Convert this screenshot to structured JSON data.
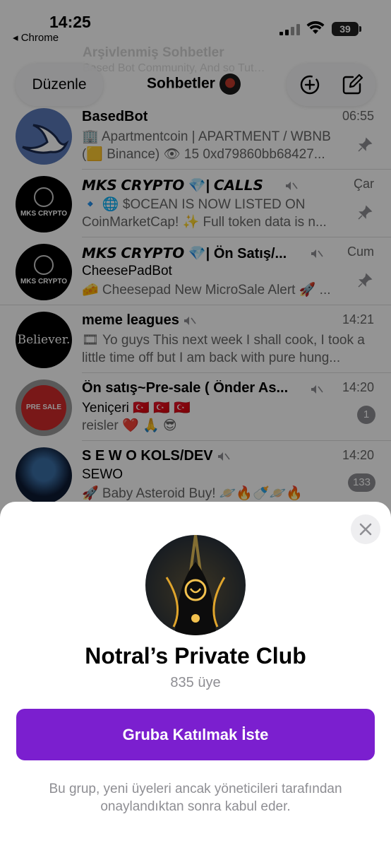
{
  "status_bar": {
    "time": "14:25",
    "back_app": "◂ Chrome",
    "battery": "39"
  },
  "archived": {
    "title": "Arşivlenmiş Sohbetler",
    "subtitle": "Based Bot Community, And so Tut…"
  },
  "nav": {
    "edit_label": "Düzenle",
    "title": "Sohbetler"
  },
  "chats": [
    {
      "name": "BasedBot",
      "time": "06:55",
      "preview": "🏢 Apartmentcoin | APARTMENT / WBNB (🟨 Binance) 👁 15 0xd79860bb68427...",
      "pinned": true
    },
    {
      "name": "𝙈𝙆𝙎 𝘾𝙍𝙔𝙋𝙏𝙊 💎| 𝘾𝘼𝙇𝙇𝙎",
      "time": "Çar",
      "preview": "🔹 🌐 $OCEAN IS NOW LISTED ON CoinMarketCap! ✨ Full token data is n...",
      "muted": true,
      "pinned": true,
      "avatar_text": "MKS CRYPTO"
    },
    {
      "name": "𝙈𝙆𝙎 𝘾𝙍𝙔𝙋𝙏𝙊 💎| Ön Satış/...",
      "time": "Cum",
      "sender": "CheesePadBot",
      "preview": "🧀 Cheesepad New MicroSale Alert 🚀 ...",
      "muted": true,
      "pinned": true,
      "avatar_text": "MKS CRYPTO"
    },
    {
      "name": "meme leagues",
      "time": "14:21",
      "preview": "🎞 Yo guys This next week I shall cook, I took a little time off but I am back with pure hung...",
      "muted": true,
      "avatar_text": "Believer."
    },
    {
      "name": "Ön satış~Pre-sale ( Önder As...",
      "time": "14:20",
      "sender": "Yeniçeri 🇹🇷 🇹🇷 🇹🇷",
      "preview": "reisler ❤️ 🙏 😎",
      "muted": true,
      "badge": "1",
      "avatar_text": "PRE SALE"
    },
    {
      "name": "S E W O KOLS/DEV",
      "time": "14:20",
      "sender": "SEWO",
      "preview": "🚀 Baby Asteroid Buy! 🪐🔥🍼🪐🔥",
      "muted": true,
      "badge": "133"
    }
  ],
  "sheet": {
    "group_name": "Notral’s Private Club",
    "members": "835 üye",
    "join_label": "Gruba Katılmak İste",
    "note": "Bu grup, yeni üyeleri ancak yöneticileri tarafından onaylandıktan sonra kabul eder."
  },
  "colors": {
    "accent": "#7b1fcf",
    "badge": "#8e8e93"
  }
}
